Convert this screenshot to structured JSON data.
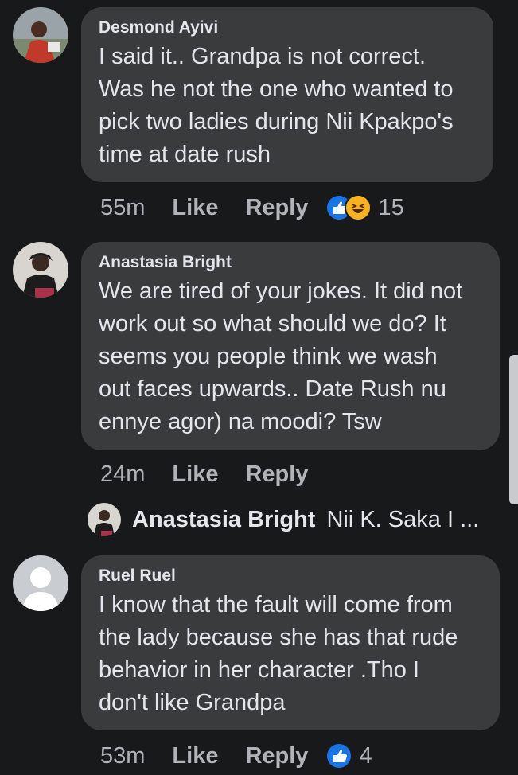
{
  "comments": [
    {
      "author": "Desmond Ayivi",
      "lines": [
        "I said it.. Grandpa is not correct.",
        "Was he not the one who wanted to",
        "pick two ladies during Nii Kpakpo's",
        "time at date rush"
      ],
      "time": "55m",
      "like_label": "Like",
      "reply_label": "Reply",
      "reaction_count": "15",
      "reactions": [
        "like-icon",
        "haha-icon"
      ]
    },
    {
      "author": "Anastasia Bright",
      "lines": [
        "We are tired of your jokes. It did not",
        "work out so what should we do? It",
        "seems you people think we wash",
        "out faces upwards.. Date Rush nu",
        "ennye agor) na moodi? Tsw"
      ],
      "time": "24m",
      "like_label": "Like",
      "reply_label": "Reply"
    },
    {
      "author": "Ruel Ruel",
      "lines": [
        "I know that the fault will come from",
        "the lady because she has that rude",
        "behavior in her character .Tho I",
        "don't like Grandpa"
      ],
      "time": "53m",
      "like_label": "Like",
      "reply_label": "Reply",
      "reaction_count": "4",
      "reactions": [
        "like-icon"
      ]
    }
  ],
  "reply_preview": {
    "author": "Anastasia Bright",
    "text": "Nii K. Saka I ..."
  },
  "colors": {
    "background": "#18191a",
    "bubble": "#3a3b3c",
    "text": "#e4e6eb",
    "muted": "#b0b3b8",
    "like_blue": "#1b74e4",
    "haha_yellow": "#f7b125"
  }
}
